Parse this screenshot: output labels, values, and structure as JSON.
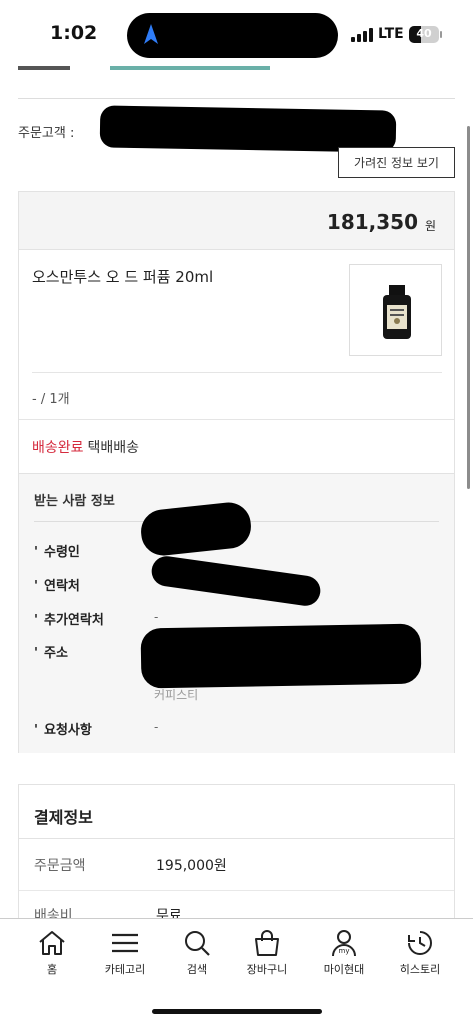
{
  "status_bar": {
    "time": "1:02",
    "network": "LTE",
    "battery": "40",
    "battery_level": 0.4
  },
  "customer": {
    "label": "주문고객 :",
    "reveal_button": "가려진 정보 보기"
  },
  "product": {
    "price": "181,350",
    "price_unit": "원",
    "name": "오스만투스 오 드 퍼퓸 20ml",
    "option": "- / 1개",
    "status": "배송완료",
    "delivery_method": "택배배송"
  },
  "recipient": {
    "title": "받는 사람 정보",
    "fields": [
      {
        "label": "수령인",
        "value": ""
      },
      {
        "label": "연락처",
        "value": ""
      },
      {
        "label": "추가연락처",
        "value": "-"
      },
      {
        "label": "주소",
        "value": ""
      },
      {
        "label": "요청사항",
        "value": "-"
      }
    ],
    "address_tail": "커피스티"
  },
  "payment": {
    "title": "결제정보",
    "rows": [
      {
        "label": "주문금액",
        "value": "195,000원"
      },
      {
        "label": "배송비",
        "value": "무료"
      }
    ]
  },
  "tabbar": {
    "items": [
      {
        "label": "홈",
        "icon": "home-icon"
      },
      {
        "label": "카테고리",
        "icon": "menu-icon"
      },
      {
        "label": "검색",
        "icon": "search-icon"
      },
      {
        "label": "장바구니",
        "icon": "shopping-bag-icon"
      },
      {
        "label": "마이현대",
        "icon": "my-profile-icon"
      },
      {
        "label": "히스토리",
        "icon": "history-icon"
      }
    ]
  },
  "colors": {
    "status_done": "#d52b3e",
    "border": "#e2e2e2",
    "section_bg": "#f4f4f4"
  }
}
